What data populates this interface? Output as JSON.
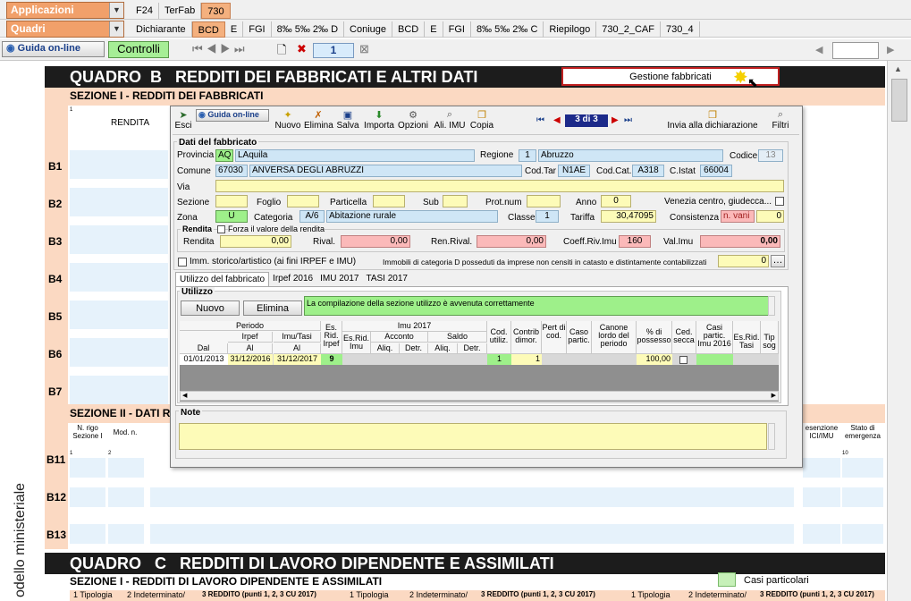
{
  "top": {
    "applicazioni": "Applicazioni",
    "quadri": "Quadri",
    "tabs1": [
      "F24",
      "TerFab",
      "730"
    ],
    "tabs2": [
      "Dichiarante",
      "BCD",
      "E",
      "FGI",
      "8‰ 5‰ 2‰ D",
      "Coniuge",
      "BCD",
      "E",
      "FGI",
      "8‰ 5‰ 2‰ C",
      "Riepilogo",
      "730_2_CAF",
      "730_4"
    ]
  },
  "toolbar": {
    "guida": "Guida on-line",
    "controlli": "Controlli",
    "page": "1"
  },
  "form": {
    "quadro_b_title": "QUADRO  B   REDDITI DEI FABBRICATI E ALTRI DATI",
    "gestione": "Gestione fabbricati",
    "sez1": "SEZIONE I - REDDITI DEI FABBRICATI",
    "rendita_hdr": "RENDITA",
    "col_num": "1",
    "rows_b": [
      "B1",
      "B2",
      "B3",
      "B4",
      "B5",
      "B6",
      "B7"
    ],
    "sez2": "SEZIONE II -  DATI R",
    "nrigo": "N. rigo Sezione I",
    "modn": "Mod. n.",
    "esenz": "esenzione ICI/IMU",
    "stato": "Stato di emergenza",
    "rows_b2": [
      "B11",
      "B12",
      "B13"
    ],
    "num1": "1",
    "num2": "2",
    "num10": "10",
    "side": "odello ministeriale",
    "quadro_c_title": "QUADRO   C   REDDITI DI LAVORO DIPENDENTE E ASSIMILATI",
    "sezc1": "SEZIONE I - REDDITI DI LAVORO DIPENDENTE E ASSIMILATI",
    "casi": "Casi particolari",
    "c_col1": "1  Tipologia",
    "c_col2": "2  Indeterminato/",
    "c_col3": "3 REDDITO (punti 1, 2, 3 CU 2017)"
  },
  "dialog": {
    "tools": [
      "Esci",
      "Guida on-line",
      "Nuovo",
      "Elimina",
      "Salva",
      "Importa",
      "Opzioni",
      "Ali. IMU",
      "Copia"
    ],
    "nav": "3 di 3",
    "invia": "Invia alla dichiarazione",
    "filtri": "Filtri",
    "dati": "Dati del fabbricato",
    "provincia_l": "Provincia",
    "provincia": "AQ",
    "citta": "LAquila",
    "regione_l": "Regione",
    "regione_n": "1",
    "regione": "Abruzzo",
    "codice_l": "Codice",
    "codice": "13",
    "comune_l": "Comune",
    "comune_c": "67030",
    "comune": "ANVERSA DEGLI ABRUZZI",
    "codtar_l": "Cod.Tar",
    "codtar": "N1AE",
    "codcat_l": "Cod.Cat.",
    "codcat": "A318",
    "cistat_l": "C.Istat",
    "cistat": "66004",
    "via_l": "Via",
    "sezione_l": "Sezione",
    "foglio_l": "Foglio",
    "particella_l": "Particella",
    "sub_l": "Sub",
    "protnum_l": "Prot.num",
    "anno_l": "Anno",
    "anno": "0",
    "venezia": "Venezia centro, giudecca...",
    "zona_l": "Zona",
    "zona": "U",
    "categoria_l": "Categoria",
    "categoria": "A/6",
    "cat_desc": "Abitazione rurale",
    "classe_l": "Classe",
    "classe": "1",
    "tariffa_l": "Tariffa",
    "tariffa": "30,47095",
    "consistenza_l": "Consistenza",
    "nvani": "n. vani",
    "consistenza": "0",
    "rendita_grp": "Rendita",
    "forza": "Forza il valore della rendita",
    "rendita_l": "Rendita",
    "rendita": "0,00",
    "rival_l": "Rival.",
    "rival": "0,00",
    "renrival_l": "Ren.Rival.",
    "renrival": "0,00",
    "coeff_l": "Coeff.Riv.Imu",
    "coeff": "160",
    "valimu_l": "Val.Imu",
    "valimu": "0,00",
    "imm_storico": "Imm. storico/artistico (ai fini IRPEF e IMU)",
    "imm_d": "Immobili di categoria D posseduti da imprese non censiti in catasto e distintamente contabilizzati",
    "imm_d_val": "0",
    "tabs": [
      "Utilizzo del fabbricato",
      "Irpef 2016",
      "IMU 2017",
      "TASI 2017"
    ],
    "utilizzo": "Utilizzo",
    "nuovo": "Nuovo",
    "elimina": "Elimina",
    "msg": "La compilazione della sezione utilizzo è avvenuta correttamente",
    "grid": {
      "periodo": "Periodo",
      "irpef": "Irpef",
      "imutasi": "Imu/Tasi",
      "dal": "Dal",
      "al": "Al",
      "al2": "Al",
      "esrid": "Es. Rid. Irpef",
      "imu2017": "Imu 2017",
      "esridimu": "Es.Rid. Imu",
      "acconto": "Acconto",
      "saldo": "Saldo",
      "aliq": "Aliq.",
      "detr": "Detr.",
      "aliq2": "Aliq.",
      "detr2": "Detr.",
      "codutil": "Cod. utiliz.",
      "contrib": "Contrib dimor.",
      "pert": "Pert di cod.",
      "caso": "Caso partic.",
      "canone": "Canone lordo del periodo",
      "poss": "% di possesso",
      "cedsecca": "Ced. secca",
      "casipartic": "Casi partic. Imu 2016",
      "esridtasi": "Es.Rid. Tasi",
      "tipsog": "Tip sog",
      "row": {
        "dal": "01/01/2013",
        "al": "31/12/2016",
        "al2": "31/12/2017",
        "esrid": "9",
        "cod": "1",
        "contrib": "1",
        "poss": "100,00"
      }
    },
    "note": "Note"
  }
}
